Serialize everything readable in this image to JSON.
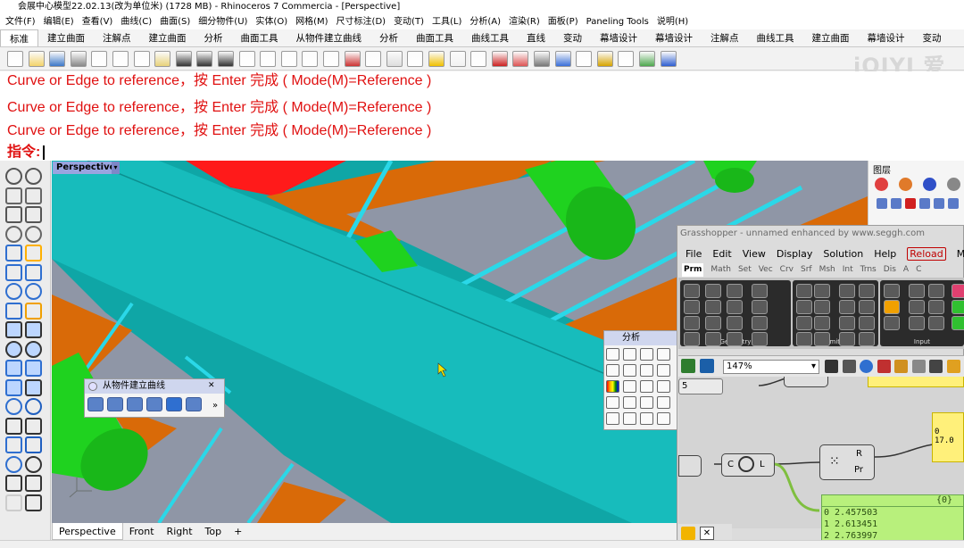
{
  "window": {
    "title": "会展中心模型22.02.13(改为单位米) (1728 MB) - Rhinoceros 7 Commercia - [Perspective]"
  },
  "menu": [
    "文件(F)",
    "编辑(E)",
    "查看(V)",
    "曲线(C)",
    "曲面(S)",
    "细分物件(U)",
    "实体(O)",
    "网格(M)",
    "尺寸标注(D)",
    "变动(T)",
    "工具(L)",
    "分析(A)",
    "渲染(R)",
    "面板(P)",
    "Paneling Tools",
    "说明(H)"
  ],
  "tabs": [
    "标准",
    "建立曲面",
    "注解点",
    "建立曲面",
    "分析",
    "曲面工具",
    "从物件建立曲线",
    "分析",
    "曲面工具",
    "曲线工具",
    "直线",
    "变动",
    "幕墙设计",
    "幕墙设计",
    "注解点",
    "曲线工具",
    "建立曲面",
    "幕墙设计",
    "变动"
  ],
  "watermark": "iQIYI 爱奇",
  "command": {
    "line1": "Curve or Edge to reference，按 Enter 完成 ( Mode(M)=Reference )",
    "line2": "Curve or Edge to reference，按 Enter 完成 ( Mode(M)=Reference )",
    "line3": "Curve or Edge to reference，按 Enter 完成 ( Mode(M)=Reference )",
    "prompt": "指令:"
  },
  "viewport": {
    "label": "Perspective",
    "tabs": [
      "Perspective",
      "Front",
      "Right",
      "Top",
      "+"
    ]
  },
  "float_curve": {
    "title": "从物件建立曲线",
    "more": "»"
  },
  "float_analysis": {
    "title": "分析"
  },
  "layers": {
    "title": "图层"
  },
  "grasshopper": {
    "title": "Grasshopper - unnamed  enhanced by www.seggh.com",
    "menu": [
      "File",
      "Edit",
      "View",
      "Display",
      "Solution",
      "Help"
    ],
    "reload": "Reload",
    "metahopper": "MetaHopp",
    "tabs": [
      "Prm",
      "Math",
      "Set",
      "Vec",
      "Crv",
      "Srf",
      "Msh",
      "Int",
      "Trns",
      "Dis",
      "A",
      "C"
    ],
    "panels": [
      "Geometry",
      "Primitive",
      "Input"
    ],
    "zoom": "147%",
    "node_c": "C",
    "node_l": "L",
    "node_r": "R",
    "node_pr": "Pr",
    "side_number": "5",
    "yellow_value": "0 17.0",
    "panel_header": "{0}",
    "values": [
      "0  2.457503",
      "1  2.613451",
      "2  2.763997"
    ]
  },
  "colors": {
    "viewport_bg": "#0fa6a6",
    "beam_teal": "#17bcbc",
    "orange": "#d96a08",
    "red": "#ff1a1a",
    "green": "#1fd21f",
    "command_red": "#e01010"
  }
}
